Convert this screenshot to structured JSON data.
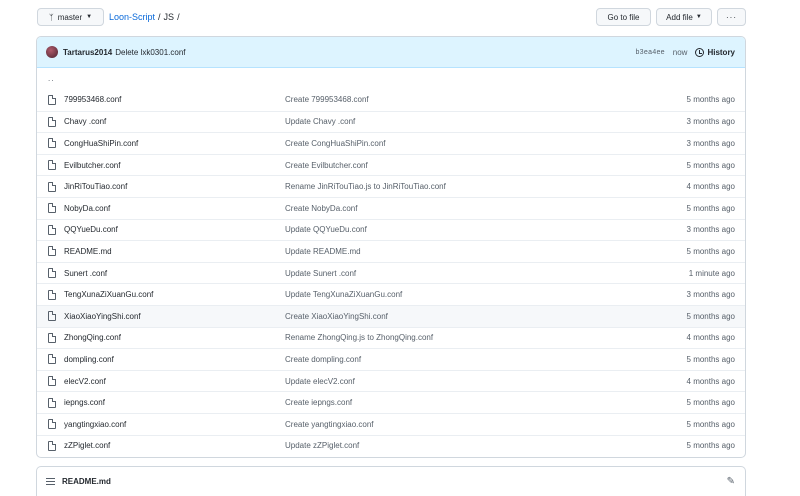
{
  "toolbar": {
    "branch_label": "master",
    "goto_file_label": "Go to file",
    "add_file_label": "Add file",
    "more_label": "···"
  },
  "breadcrumb": {
    "repo": "Loon-Script",
    "separator": "/",
    "dir": "JS",
    "trailing": "/"
  },
  "latest_commit": {
    "author": "Tartarus2014",
    "message": "Delete lxk0301.conf",
    "sha": "b3ea4ee",
    "time": "now",
    "history_label": "History"
  },
  "parent_dir_label": "..",
  "files": [
    {
      "name": "799953468.conf",
      "message": "Create 799953468.conf",
      "age": "5 months ago"
    },
    {
      "name": "Chavy .conf",
      "message": "Update Chavy .conf",
      "age": "3 months ago"
    },
    {
      "name": "CongHuaShiPin.conf",
      "message": "Create CongHuaShiPin.conf",
      "age": "3 months ago"
    },
    {
      "name": "Evilbutcher.conf",
      "message": "Create Evilbutcher.conf",
      "age": "5 months ago"
    },
    {
      "name": "JinRiTouTiao.conf",
      "message": "Rename JinRiTouTiao.js to JinRiTouTiao.conf",
      "age": "4 months ago"
    },
    {
      "name": "NobyDa.conf",
      "message": "Create NobyDa.conf",
      "age": "5 months ago"
    },
    {
      "name": "QQYueDu.conf",
      "message": "Update QQYueDu.conf",
      "age": "3 months ago"
    },
    {
      "name": "README.md",
      "message": "Update README.md",
      "age": "5 months ago"
    },
    {
      "name": "Sunert .conf",
      "message": "Update Sunert .conf",
      "age": "1 minute ago"
    },
    {
      "name": "TengXunaZiXuanGu.conf",
      "message": "Update TengXunaZiXuanGu.conf",
      "age": "3 months ago"
    },
    {
      "name": "XiaoXiaoYingShi.conf",
      "message": "Create XiaoXiaoYingShi.conf",
      "age": "5 months ago"
    },
    {
      "name": "ZhongQing.conf",
      "message": "Rename ZhongQing.js to ZhongQing.conf",
      "age": "4 months ago"
    },
    {
      "name": "dompling.conf",
      "message": "Create dompling.conf",
      "age": "5 months ago"
    },
    {
      "name": "elecV2.conf",
      "message": "Update elecV2.conf",
      "age": "4 months ago"
    },
    {
      "name": "iepngs.conf",
      "message": "Create iepngs.conf",
      "age": "5 months ago"
    },
    {
      "name": "yangtingxiao.conf",
      "message": "Create yangtingxiao.conf",
      "age": "5 months ago"
    },
    {
      "name": "zZPiglet.conf",
      "message": "Update zZPiglet.conf",
      "age": "5 months ago"
    }
  ],
  "readme": {
    "title": "README.md"
  }
}
